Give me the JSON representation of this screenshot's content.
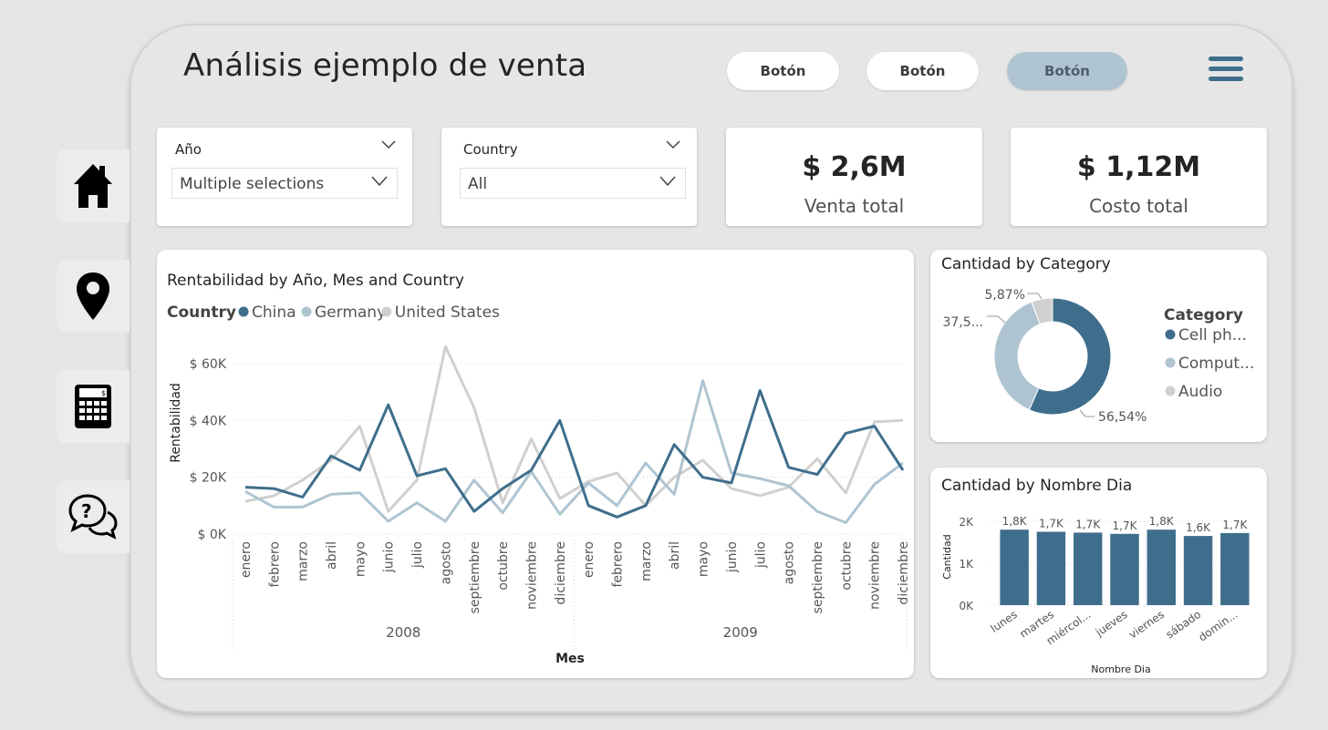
{
  "header": {
    "title": "Análisis ejemplo de venta",
    "buttons": [
      "Botón",
      "Botón",
      "Botón"
    ]
  },
  "slicers": [
    {
      "label": "Año",
      "value": "Multiple selections"
    },
    {
      "label": "Country",
      "value": "All"
    }
  ],
  "kpis": [
    {
      "value": "$ 2,6M",
      "label": "Venta total"
    },
    {
      "value": "$ 1,12M",
      "label": "Costo total"
    }
  ],
  "colors": {
    "china": "#3f6e8c",
    "germany": "#afc4d1",
    "us": "#d0d0d0",
    "accent": "#3f6e8c"
  },
  "nav_icons": [
    "home-icon",
    "map-pin-icon",
    "calculator-icon",
    "help-chat-icon"
  ],
  "line_chart": {
    "title": "Rentabilidad by Año, Mes and Country",
    "legend_title": "Country",
    "ylabel": "Rentabilidad",
    "xlabel": "Mes",
    "y_ticks": [
      "$ 60K",
      "$ 40K",
      "$ 20K",
      "$ 0K"
    ],
    "months": [
      "enero",
      "febrero",
      "marzo",
      "abril",
      "mayo",
      "junio",
      "julio",
      "agosto",
      "septiembre",
      "octubre",
      "noviembre",
      "diciembre"
    ],
    "years": [
      "2008",
      "2009"
    ]
  },
  "donut_chart": {
    "title": "Cantidad by Category",
    "legend_title": "Category",
    "legend": [
      "Cell ph...",
      "Comput...",
      "Audio"
    ],
    "labels": [
      "56,54%",
      "37,5...",
      "5,87%"
    ]
  },
  "bar_chart": {
    "title": "Cantidad by Nombre Dia",
    "ylabel": "Cantidad",
    "xlabel": "Nombre Dia",
    "y_ticks": [
      "2K",
      "1K",
      "0K"
    ],
    "data_labels": [
      "1,8K",
      "1,7K",
      "1,7K",
      "1,7K",
      "1,8K",
      "1,6K",
      "1,7K"
    ]
  },
  "chart_data": [
    {
      "type": "line",
      "title": "Rentabilidad by Año, Mes and Country",
      "xlabel": "Mes",
      "ylabel": "Rentabilidad",
      "x": [
        "enero 2008",
        "febrero 2008",
        "marzo 2008",
        "abril 2008",
        "mayo 2008",
        "junio 2008",
        "julio 2008",
        "agosto 2008",
        "septiembre 2008",
        "octubre 2008",
        "noviembre 2008",
        "diciembre 2008",
        "enero 2009",
        "febrero 2009",
        "marzo 2009",
        "abril 2009",
        "mayo 2009",
        "junio 2009",
        "julio 2009",
        "agosto 2009",
        "septiembre 2009",
        "octubre 2009",
        "noviembre 2009",
        "diciembre 2009"
      ],
      "ylim": [
        0,
        60000
      ],
      "legend_position": "top-left",
      "series": [
        {
          "name": "China",
          "values": [
            16500,
            16000,
            13000,
            27500,
            22500,
            45500,
            20500,
            23000,
            8000,
            16000,
            22500,
            40000,
            10000,
            6000,
            10000,
            31500,
            20000,
            18000,
            50500,
            23500,
            21000,
            35500,
            38000,
            22500
          ]
        },
        {
          "name": "Germany",
          "values": [
            15000,
            9500,
            9500,
            14000,
            14500,
            4500,
            11000,
            4500,
            19000,
            7500,
            22000,
            7000,
            18000,
            10000,
            25000,
            14000,
            54000,
            21500,
            19500,
            17000,
            8000,
            4000,
            17500,
            25000
          ]
        },
        {
          "name": "United States",
          "values": [
            11500,
            13500,
            19000,
            26000,
            38000,
            8000,
            19000,
            66000,
            44500,
            11000,
            33500,
            12500,
            18500,
            21500,
            10000,
            20000,
            26000,
            16000,
            13500,
            16500,
            26500,
            14500,
            39500,
            40000
          ]
        }
      ]
    },
    {
      "type": "pie",
      "title": "Cantidad by Category",
      "categories": [
        "Cell ph...",
        "Comput...",
        "Audio"
      ],
      "values": [
        56.54,
        37.59,
        5.87
      ]
    },
    {
      "type": "bar",
      "title": "Cantidad by Nombre Dia",
      "xlabel": "Nombre Dia",
      "ylabel": "Cantidad",
      "categories": [
        "lunes",
        "martes",
        "miércol...",
        "jueves",
        "viernes",
        "sábado",
        "domin..."
      ],
      "values": [
        1800,
        1750,
        1730,
        1700,
        1800,
        1650,
        1720
      ],
      "ylim": [
        0,
        2000
      ]
    }
  ]
}
